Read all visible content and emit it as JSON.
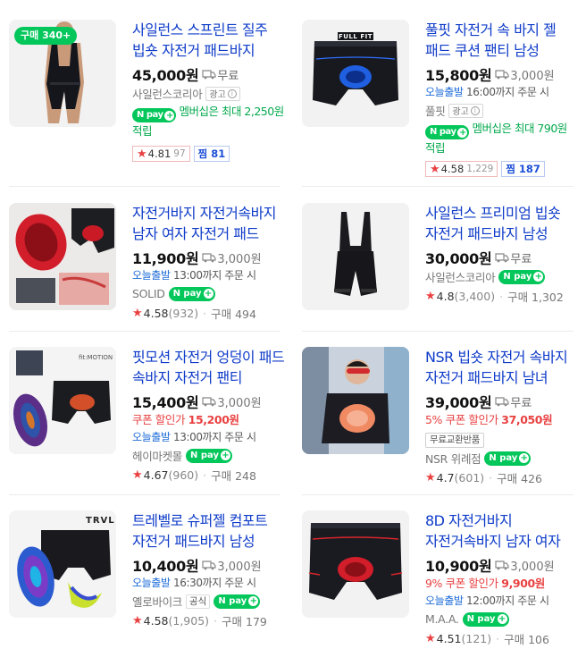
{
  "products": [
    {
      "title": "사일런스 스프린트 질주 빕숏 자전거 패드바지",
      "sold_badge": "구매 340+",
      "price": "45,000원",
      "shipping": "무료",
      "seller": "사일런스코리아",
      "ad_label": "광고",
      "member_text": "멤버십은 최대 2,250원 적립",
      "rating": "4.81",
      "reviews": "97",
      "zzim": "찜 81"
    },
    {
      "title": "풀핏 자전거 속 바지 젤 패드 쿠션 팬티 남성",
      "price": "15,800원",
      "shipping": "3,000원",
      "delivery_hl": "오늘출발",
      "delivery_rest": " 16:00까지 주문 시",
      "seller": "풀핏",
      "ad_label": "광고",
      "member_text": "멤버십은 최대 790원 적립",
      "rating": "4.58",
      "reviews": "1,229",
      "zzim": "찜 187"
    },
    {
      "title": "자전거바지 자전거속바지 남자 여자 자전거 패드",
      "price": "11,900원",
      "shipping": "3,000원",
      "delivery_hl": "오늘출발",
      "delivery_rest": " 13:00까지 주문 시",
      "seller": "SOLID",
      "rating": "4.58",
      "reviews": "(932)",
      "purchases": "구매 494"
    },
    {
      "title": "사일런스 프리미엄 빕숏 자전거 패드바지 남성",
      "price": "30,000원",
      "shipping": "무료",
      "seller": "사일런스코리아",
      "rating": "4.8",
      "reviews": "(3,400)",
      "purchases": "구매 1,302"
    },
    {
      "title": "핏모션 자전거 엉덩이 패드 속바지 자전거 팬티",
      "price": "15,400원",
      "shipping": "3,000원",
      "coupon_label": "쿠폰 할인가",
      "coupon_price": "15,200원",
      "delivery_hl": "오늘출발",
      "delivery_rest": " 13:00까지 주문 시",
      "seller": "헤이마켓몰",
      "rating": "4.67",
      "reviews": "(960)",
      "purchases": "구매 248"
    },
    {
      "title": "NSR 빕숏 자전거 속바지 자전거 패드바지 남녀",
      "price": "39,000원",
      "shipping": "무료",
      "coupon_label": "5% 쿠폰 할인가",
      "coupon_price": "37,050원",
      "refund_tag": "무료교환반품",
      "seller": "NSR 위례점",
      "rating": "4.7",
      "reviews": "(601)",
      "purchases": "구매 426"
    },
    {
      "title": "트레벨로 슈퍼젤 컴포트 자전거 패드바지 남성",
      "price": "10,400원",
      "shipping": "3,000원",
      "delivery_hl": "오늘출발",
      "delivery_rest": " 16:30까지 주문 시",
      "seller": "옐로바이크",
      "official": "공식",
      "rating": "4.58",
      "reviews": "(1,905)",
      "purchases": "구매 179"
    },
    {
      "title": "8D 자전거바지 자전거속바지 남자 여자 패드",
      "price": "10,900원",
      "shipping": "3,000원",
      "coupon_label": "9% 쿠폰 할인가",
      "coupon_price": "9,900원",
      "delivery_hl": "오늘출발",
      "delivery_rest": " 12:00까지 주문 시",
      "seller": "M.A.A.",
      "rating": "4.51",
      "reviews": "(121)",
      "purchases": "구매 106"
    }
  ],
  "npay_label": "N pay",
  "thumb_logos": {
    "fullfit": "FULL FIT",
    "fitmotion": "fit:MOTION",
    "trvl": "TRVL"
  },
  "colors": {
    "title_blue": "#0f3cc9",
    "npay_green": "#03c75a",
    "coupon_red": "#e94141"
  }
}
